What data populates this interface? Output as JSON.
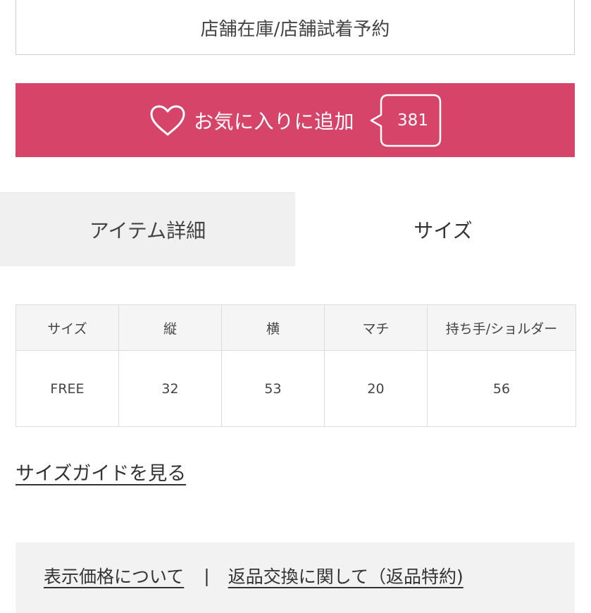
{
  "store_button": {
    "label": "店舗在庫/店舗試着予約"
  },
  "favorite": {
    "label": "お気に入りに追加",
    "count": "381",
    "icon": "heart-outline-icon",
    "color": "#d6446a"
  },
  "tabs": [
    {
      "label": "アイテム詳細",
      "active": false
    },
    {
      "label": "サイズ",
      "active": true
    }
  ],
  "size_table": {
    "headers": [
      "サイズ",
      "縦",
      "横",
      "マチ",
      "持ち手/ショルダー"
    ],
    "rows": [
      [
        "FREE",
        "32",
        "53",
        "20",
        "56"
      ]
    ]
  },
  "size_guide": {
    "label": "サイズガイドを見る"
  },
  "footer": {
    "link1": "表示価格について",
    "separator": "|",
    "link2": "返品交換に関して（返品特約)"
  }
}
